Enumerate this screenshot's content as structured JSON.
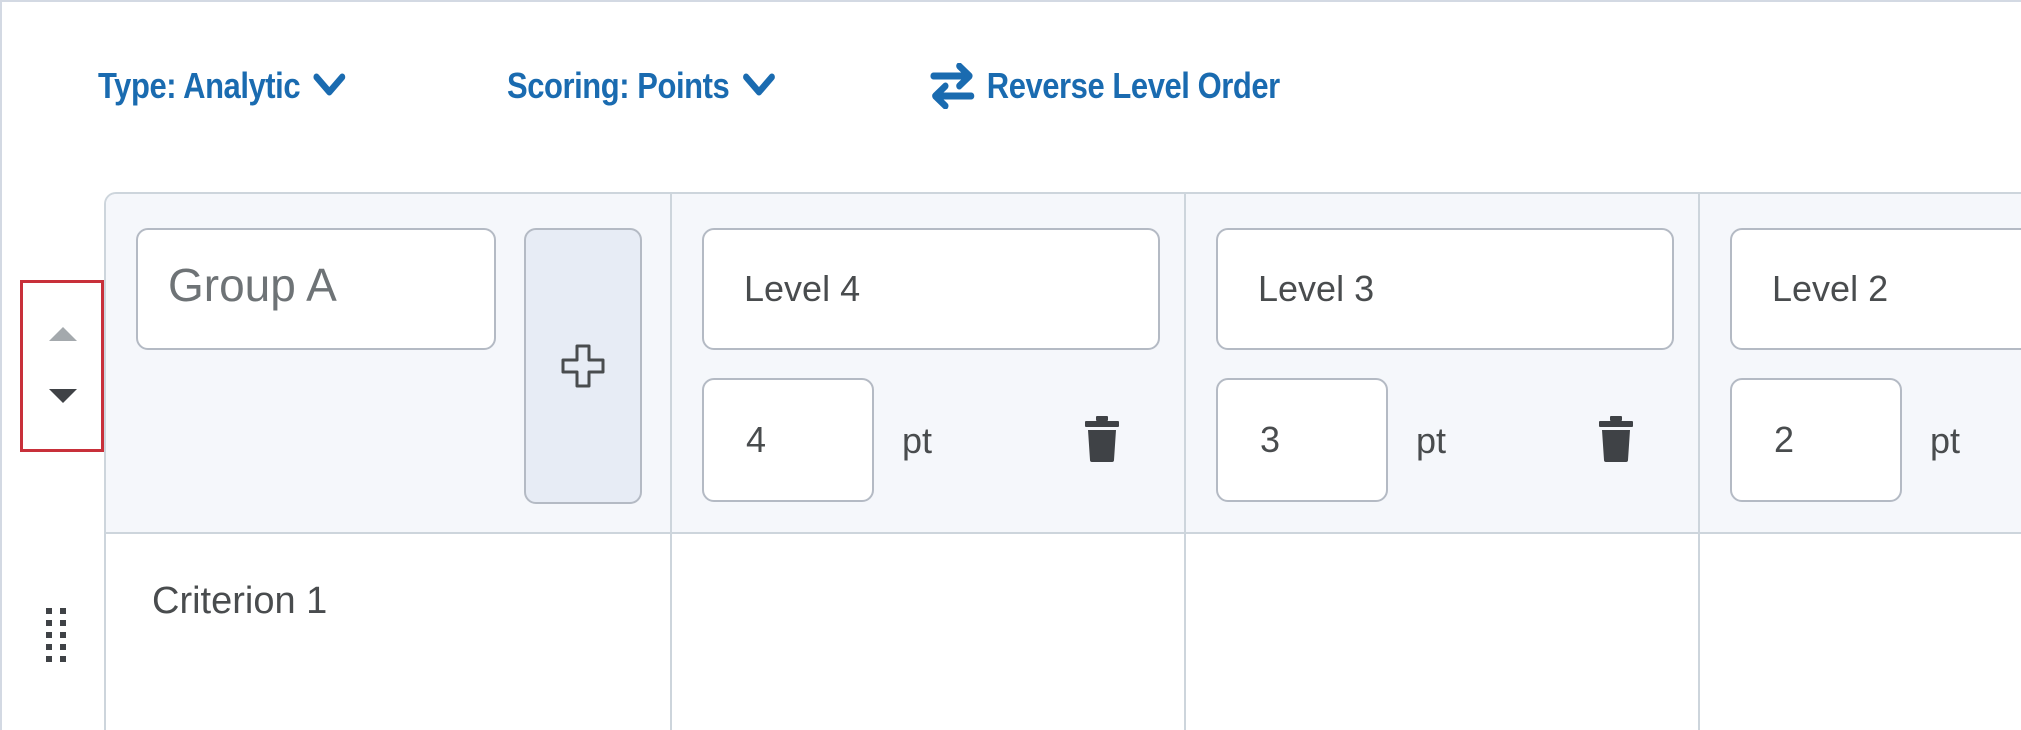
{
  "toolbar": {
    "type_label": "Type: Analytic",
    "scoring_label": "Scoring: Points",
    "reverse_label": "Reverse Level Order"
  },
  "colors": {
    "accent": "#1a6bb0",
    "highlight_border": "#c8303a",
    "header_bg": "#f5f7fb",
    "add_button_bg": "#e7ecf5"
  },
  "icons": {
    "type_dropdown": "chevron-down-icon",
    "scoring_dropdown": "chevron-down-icon",
    "reverse": "swap-arrows-icon",
    "move_up": "caret-up-icon",
    "move_down": "caret-down-icon",
    "add_level": "plus-icon",
    "delete_level": "trash-icon",
    "drag": "drag-handle-icon"
  },
  "rubric": {
    "group_name": "Group A",
    "levels": [
      {
        "name": "Level 4",
        "points": "4",
        "unit": "pt"
      },
      {
        "name": "Level 3",
        "points": "3",
        "unit": "pt"
      },
      {
        "name": "Level 2",
        "points": "2",
        "unit": "pt"
      }
    ],
    "criteria": [
      {
        "name": "Criterion 1"
      }
    ]
  }
}
